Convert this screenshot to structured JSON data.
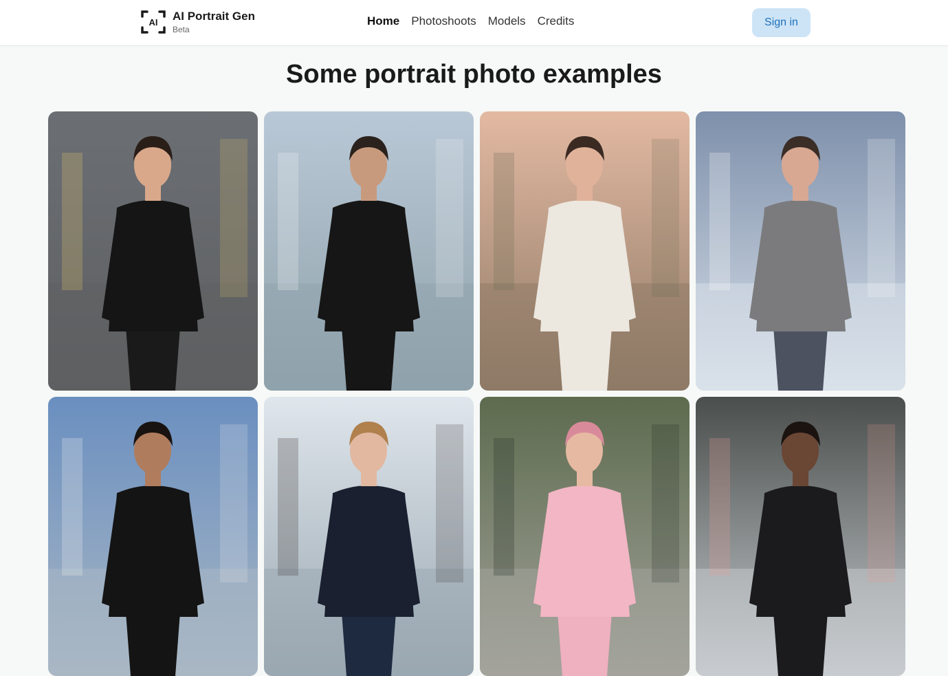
{
  "header": {
    "brand_icon": "ai-scan-logo-icon",
    "brand_title": "AI Portrait Gen",
    "brand_badge": "Beta",
    "nav": [
      {
        "label": "Home",
        "active": true
      },
      {
        "label": "Photoshoots",
        "active": false
      },
      {
        "label": "Models",
        "active": false
      },
      {
        "label": "Credits",
        "active": false
      }
    ],
    "signin_label": "Sign in"
  },
  "main": {
    "heading": "Some portrait photo examples",
    "photos": [
      {
        "name": "photo-woman-black-dress-city-street",
        "bg_top": "#6b6f74",
        "bg_bottom": "#5e5f61",
        "skin": "#d9a88b",
        "hair": "#2a1e18",
        "top": "#151515",
        "bottom": "#1a1a1a",
        "accent": "#e8c96a"
      },
      {
        "name": "photo-man-black-suit-skyscrapers",
        "bg_top": "#b9c8d6",
        "bg_bottom": "#8fa2ab",
        "skin": "#c89a7d",
        "hair": "#2b221d",
        "top": "#161616",
        "bottom": "#161616",
        "accent": "#f4f4f4"
      },
      {
        "name": "photo-woman-white-dress-desert",
        "bg_top": "#e3b9a2",
        "bg_bottom": "#8e7a66",
        "skin": "#e0b29a",
        "hair": "#3b2a22",
        "top": "#ece7df",
        "bottom": "#ece7df",
        "accent": "#6b6b52"
      },
      {
        "name": "photo-man-grey-coat-mountains",
        "bg_top": "#7e90ab",
        "bg_bottom": "#d9e1ea",
        "skin": "#d8a893",
        "hair": "#3a2e27",
        "top": "#7b7b7d",
        "bottom": "#4c5260",
        "accent": "#ffffff"
      },
      {
        "name": "photo-man-black-suit-city-balcony",
        "bg_top": "#6a8fc0",
        "bg_bottom": "#a9b7c4",
        "skin": "#b07c5e",
        "hair": "#181310",
        "top": "#141414",
        "bottom": "#141414",
        "accent": "#f2f2f2"
      },
      {
        "name": "photo-man-navy-shirt-ocean-cliff",
        "bg_top": "#dfe6ec",
        "bg_bottom": "#9aa7b1",
        "skin": "#e2b8a1",
        "hair": "#b0804d",
        "top": "#1a2030",
        "bottom": "#1d2a3f",
        "accent": "#3a3430"
      },
      {
        "name": "photo-woman-pink-outfit-park",
        "bg_top": "#5d6b4e",
        "bg_bottom": "#a3a39c",
        "skin": "#e6b9a3",
        "hair": "#d98a9a",
        "top": "#f2b6c4",
        "bottom": "#efb0c0",
        "accent": "#1f2a22"
      },
      {
        "name": "photo-man-pink-shirt-glass-building",
        "bg_top": "#4a4e4c",
        "bg_bottom": "#c7ccd0",
        "skin": "#6a4634",
        "hair": "#1a1310",
        "top": "#1b1b1d",
        "bottom": "#1b1b1d",
        "accent": "#e89a92"
      }
    ]
  }
}
